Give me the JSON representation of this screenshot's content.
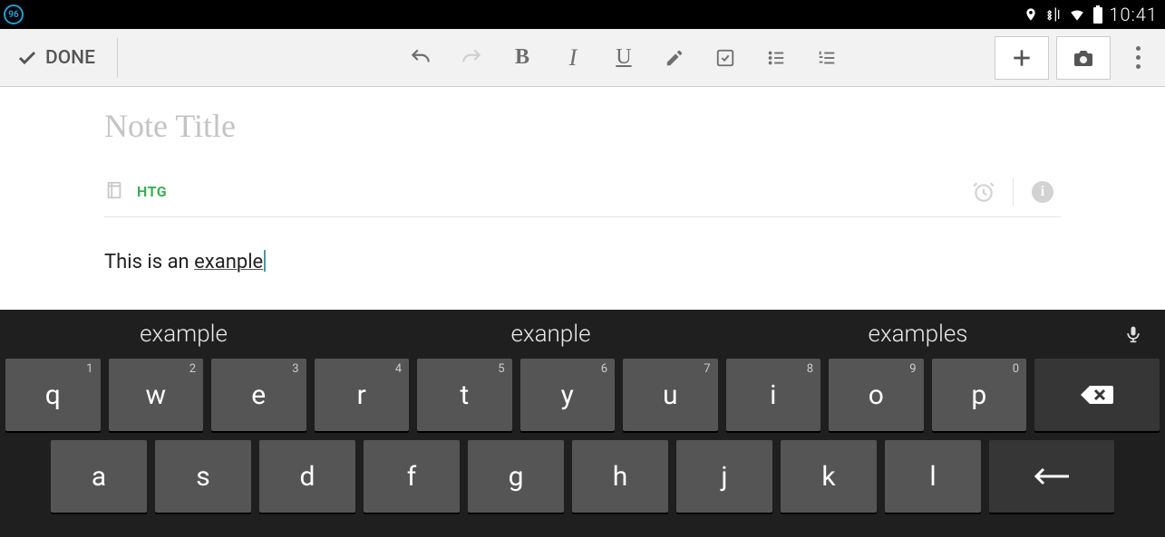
{
  "status": {
    "badge": "96",
    "time": "10:41"
  },
  "toolbar": {
    "done_label": "DONE",
    "bold": "B",
    "italic": "I",
    "underline": "U"
  },
  "note": {
    "title_placeholder": "Note Title",
    "notebook": "HTG",
    "content_prefix": "This is an ",
    "content_misspelled": "exanple",
    "info_glyph": "i"
  },
  "keyboard": {
    "suggestions": [
      "example",
      "exanple",
      "examples"
    ],
    "row1": [
      {
        "c": "q",
        "n": "1"
      },
      {
        "c": "w",
        "n": "2"
      },
      {
        "c": "e",
        "n": "3"
      },
      {
        "c": "r",
        "n": "4"
      },
      {
        "c": "t",
        "n": "5"
      },
      {
        "c": "y",
        "n": "6"
      },
      {
        "c": "u",
        "n": "7"
      },
      {
        "c": "i",
        "n": "8"
      },
      {
        "c": "o",
        "n": "9"
      },
      {
        "c": "p",
        "n": "0"
      }
    ],
    "row2": [
      "a",
      "s",
      "d",
      "f",
      "g",
      "h",
      "j",
      "k",
      "l"
    ]
  }
}
